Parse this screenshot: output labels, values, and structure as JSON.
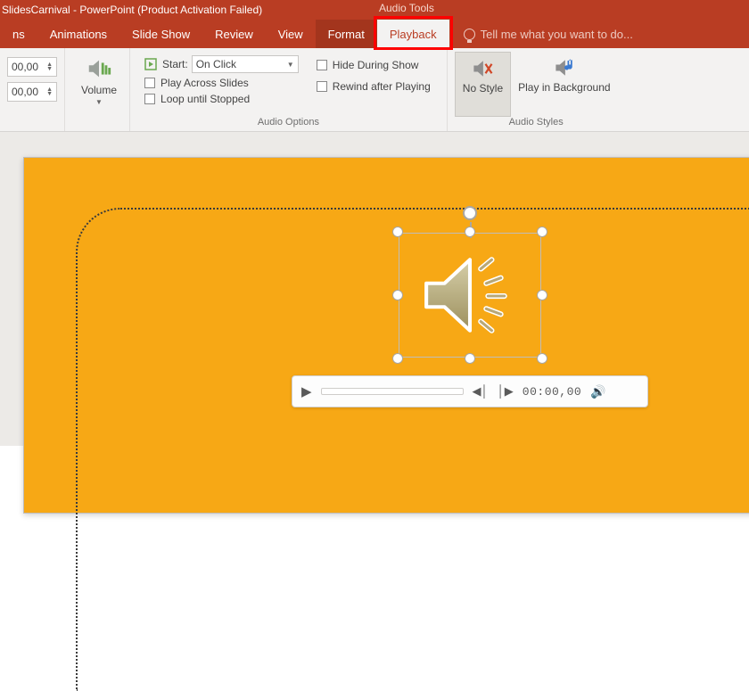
{
  "titlebar": {
    "title": "SlidesCarnival - PowerPoint (Product Activation Failed)",
    "tool_context": "Audio Tools"
  },
  "tabs": {
    "items": [
      "ns",
      "Animations",
      "Slide Show",
      "Review",
      "View",
      "Format",
      "Playback"
    ],
    "active": "Playback",
    "tell_me_placeholder": "Tell me what you want to do..."
  },
  "ribbon": {
    "time_inputs": {
      "fade_in": "00,00",
      "fade_out": "00,00"
    },
    "volume_label": "Volume",
    "audio_options": {
      "start_label": "Start:",
      "start_value": "On Click",
      "play_across": "Play Across Slides",
      "loop": "Loop until Stopped",
      "hide": "Hide During Show",
      "rewind": "Rewind after Playing",
      "group_label": "Audio Options"
    },
    "styles": {
      "no_style": "No Style",
      "play_bg": "Play in Background",
      "group_label": "Audio Styles"
    }
  },
  "player": {
    "time": "00:00,00"
  },
  "colors": {
    "brand": "#b93d23",
    "slide_bg": "#f7a815"
  }
}
